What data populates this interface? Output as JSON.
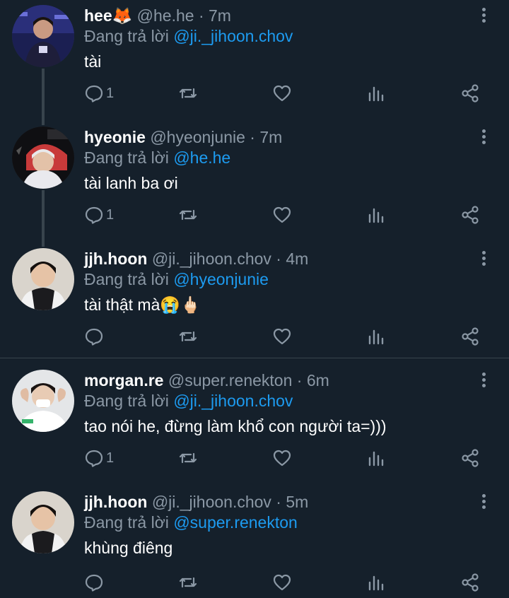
{
  "reply_prefix": "Đang trả lời",
  "colors": {
    "background": "#15202b",
    "mention": "#1d9bf0",
    "muted": "#8b98a5",
    "thread_line": "#38444d"
  },
  "tweets": [
    {
      "name": "hee🦊",
      "meta": "@he.he · 7m",
      "reply_to": "@ji._jihoon.chov",
      "text": "tài",
      "reply_count": "1",
      "avatar": "avatar-hee"
    },
    {
      "name": "hyeonie",
      "meta": "@hyeonjunie · 7m",
      "reply_to": "@he.he",
      "text": "tài lanh ba ơi",
      "reply_count": "1",
      "avatar": "avatar-hyeonie"
    },
    {
      "name": "jjh.hoon",
      "meta": "@ji._jihoon.chov · 4m",
      "reply_to": "@hyeonjunie",
      "text": "tài thật mà😭🖕🏻",
      "reply_count": "",
      "avatar": "avatar-jjh"
    },
    {
      "name": "morgan.re",
      "meta": "@super.renekton · 6m",
      "reply_to": "@ji._jihoon.chov",
      "text": "tao nói he, đừng làm khổ con người ta=)))",
      "reply_count": "1",
      "avatar": "avatar-morgan"
    },
    {
      "name": "jjh.hoon",
      "meta": "@ji._jihoon.chov · 5m",
      "reply_to": "@super.renekton",
      "text": "khùng điêng",
      "reply_count": "",
      "avatar": "avatar-jjh"
    }
  ],
  "icons": {
    "reply": "reply-icon",
    "retweet": "retweet-icon",
    "like": "heart-icon",
    "views": "analytics-icon",
    "share": "share-icon",
    "more": "more-vertical-icon"
  }
}
